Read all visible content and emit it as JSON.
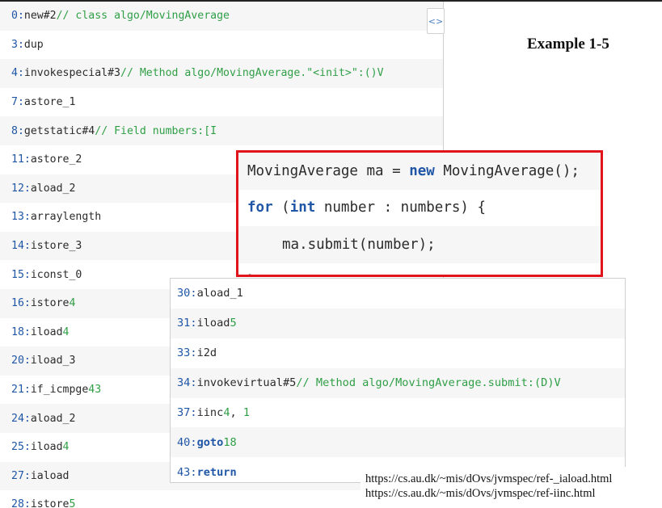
{
  "example_title": "Example 1-5",
  "left_panel": {
    "rows": [
      {
        "off": "0:",
        "op": "new",
        "arg": "#2",
        "comment": "// class algo/MovingAverage"
      },
      {
        "off": "3:",
        "op": "dup",
        "arg": "",
        "comment": ""
      },
      {
        "off": "4:",
        "op": "invokespecial",
        "arg": "#3",
        "comment": "// Method algo/MovingAverage.\"<init>\":()V"
      },
      {
        "off": "7:",
        "op": "astore_1",
        "arg": "",
        "comment": ""
      },
      {
        "off": "8:",
        "op": "getstatic",
        "arg": "#4",
        "comment": "// Field numbers:[I"
      },
      {
        "off": "11:",
        "op": "astore_2",
        "arg": "",
        "comment": ""
      },
      {
        "off": "12:",
        "op": "aload_2",
        "arg": "",
        "comment": ""
      },
      {
        "off": "13:",
        "op": "arraylength",
        "arg": "",
        "comment": ""
      },
      {
        "off": "14:",
        "op": "istore_3",
        "arg": "",
        "comment": ""
      },
      {
        "off": "15:",
        "op": "iconst_0",
        "arg": "",
        "comment": ""
      },
      {
        "off": "16:",
        "op": "istore",
        "arg": "4",
        "comment": ""
      },
      {
        "off": "18:",
        "op": "iload",
        "arg": "4",
        "comment": ""
      },
      {
        "off": "20:",
        "op": "iload_3",
        "arg": "",
        "comment": ""
      },
      {
        "off": "21:",
        "op": "if_icmpge",
        "arg": "43",
        "comment": ""
      },
      {
        "off": "24:",
        "op": "aload_2",
        "arg": "",
        "comment": ""
      },
      {
        "off": "25:",
        "op": "iload",
        "arg": "4",
        "comment": ""
      },
      {
        "off": "27:",
        "op": "iaload",
        "arg": "",
        "comment": ""
      },
      {
        "off": "28:",
        "op": "istore",
        "arg": "5",
        "comment": ""
      }
    ]
  },
  "source_code": {
    "line1": {
      "type": "MovingAverage",
      "var": " ma = ",
      "kw_new": "new",
      "call": " MovingAverage();"
    },
    "line2": {
      "kw_for": "for",
      "open": " (",
      "kw_int": "int",
      "rest": " number : numbers) {"
    },
    "line3": {
      "stmt": "ma.submit(number);"
    },
    "line4": {
      "close": "}"
    }
  },
  "right_panel": {
    "rows": [
      {
        "off": "30:",
        "op": "aload_1",
        "arg": "",
        "arg2": "",
        "comment": "",
        "op_kw": false
      },
      {
        "off": "31:",
        "op": "iload",
        "arg": "5",
        "arg2": "",
        "comment": "",
        "op_kw": false
      },
      {
        "off": "33:",
        "op": "i2d",
        "arg": "",
        "arg2": "",
        "comment": "",
        "op_kw": false
      },
      {
        "off": "34:",
        "op": "invokevirtual",
        "arg": "#5",
        "arg2": "",
        "comment": "// Method algo/MovingAverage.submit:(D)V",
        "op_kw": false
      },
      {
        "off": "37:",
        "op": "iinc",
        "arg": "4",
        "arg2": "1",
        "comment": "",
        "op_kw": false
      },
      {
        "off": "40:",
        "op": "goto",
        "arg": "18",
        "arg2": "",
        "comment": "",
        "op_kw": true
      },
      {
        "off": "43:",
        "op": "return",
        "arg": "",
        "arg2": "",
        "comment": "",
        "op_kw": true
      }
    ]
  },
  "references": [
    "https://cs.au.dk/~mis/dOvs/jvmspec/ref-_iaload.html",
    "https://cs.au.dk/~mis/dOvs/jvmspec/ref-iinc.html"
  ],
  "colors": {
    "offset": "#1f56a5",
    "keyword": "#1f56a5",
    "literal": "#2f9f46",
    "highlight_border": "#e0141a"
  },
  "icons": {
    "expand": "expand-code-icon"
  }
}
